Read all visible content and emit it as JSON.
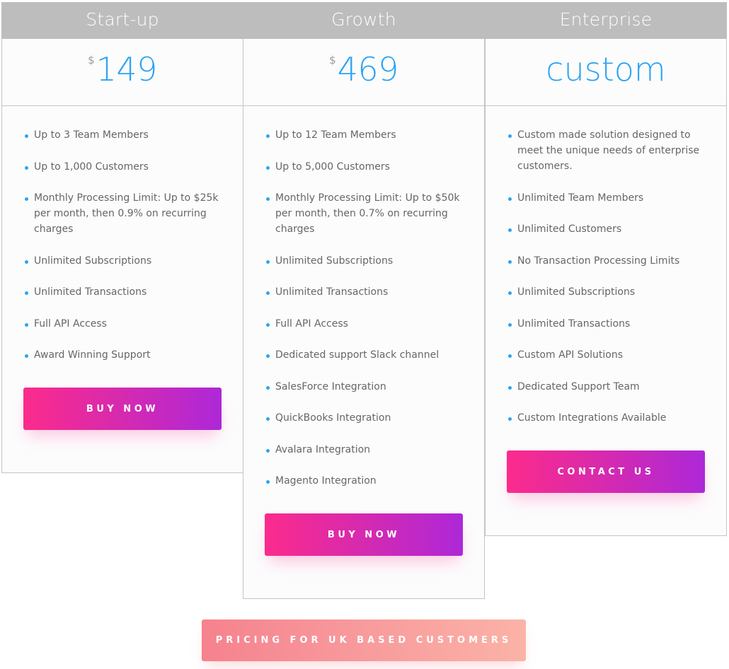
{
  "plans": [
    {
      "name": "Start-up",
      "currency": "$",
      "price": "149",
      "features": [
        "Up to 3 Team Members",
        "Up to 1,000 Customers",
        "Monthly Processing Limit: Up to $25k per month, then 0.9% on recurring charges",
        "Unlimited Subscriptions",
        "Unlimited Transactions",
        "Full API Access",
        "Award Winning Support"
      ],
      "button": "BUY NOW"
    },
    {
      "name": "Growth",
      "currency": "$",
      "price": "469",
      "features": [
        "Up to 12 Team Members",
        "Up to 5,000 Customers",
        "Monthly Processing Limit: Up to $50k per month, then 0.7% on recurring charges",
        "Unlimited Subscriptions",
        "Unlimited Transactions",
        "Full API Access",
        "Dedicated support Slack channel",
        "SalesForce Integration",
        "QuickBooks Integration",
        "Avalara Integration",
        "Magento Integration"
      ],
      "button": "BUY NOW"
    },
    {
      "name": "Enterprise",
      "price_text": "custom",
      "features": [
        "Custom made solution designed to meet the unique needs of enterprise customers.",
        "Unlimited Team Members",
        "Unlimited Customers",
        "No Transaction Processing Limits",
        "Unlimited Subscriptions",
        "Unlimited Transactions",
        "Custom API Solutions",
        "Dedicated Support Team",
        "Custom Integrations Available"
      ],
      "button": "CONTACT US"
    }
  ],
  "uk_pricing_button": "PRICING FOR UK BASED CUSTOMERS",
  "colors": {
    "header_bg": "#bdbdbd",
    "price": "#2ea3f2",
    "bullet": "#2ea3f2",
    "cta_gradient_start": "#fc2b8c",
    "cta_gradient_end": "#ad28d8",
    "uk_gradient_start": "#f6828e",
    "uk_gradient_end": "#fbb3a7"
  }
}
